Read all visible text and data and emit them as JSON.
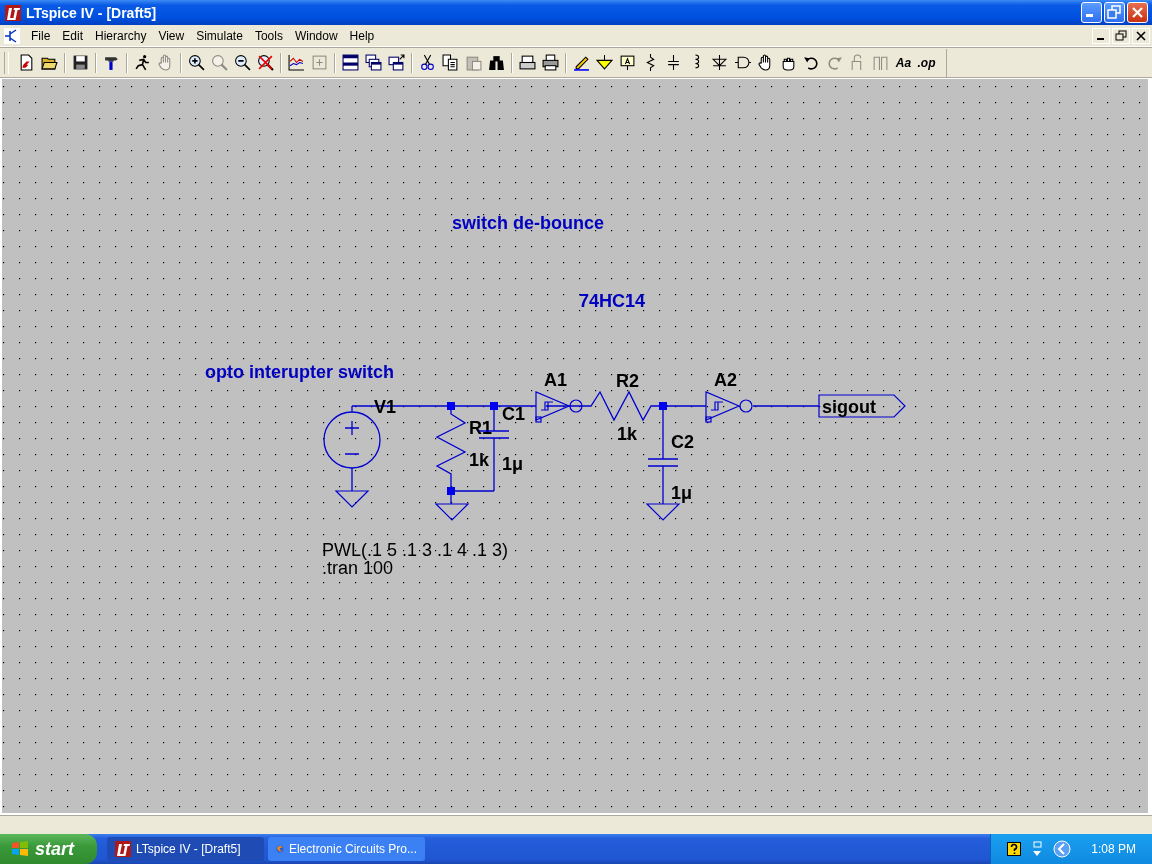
{
  "window": {
    "title": "LTspice IV - [Draft5]"
  },
  "menu": [
    "File",
    "Edit",
    "Hierarchy",
    "View",
    "Simulate",
    "Tools",
    "Window",
    "Help"
  ],
  "toolbar": [
    [
      {
        "kind": "new",
        "disabled": false
      },
      {
        "kind": "open",
        "disabled": false
      }
    ],
    [
      {
        "kind": "save",
        "disabled": false
      }
    ],
    [
      {
        "kind": "hammer",
        "disabled": false
      }
    ],
    [
      {
        "kind": "run",
        "disabled": false
      },
      {
        "kind": "halt",
        "disabled": true
      }
    ],
    [
      {
        "kind": "zoom_in",
        "disabled": false
      },
      {
        "kind": "pan",
        "disabled": true
      },
      {
        "kind": "zoom_out",
        "disabled": false
      },
      {
        "kind": "zoom_cancel",
        "disabled": false
      }
    ],
    [
      {
        "kind": "plot",
        "disabled": false
      },
      {
        "kind": "autorange",
        "disabled": true
      }
    ],
    [
      {
        "kind": "tile",
        "disabled": false
      },
      {
        "kind": "cascade",
        "disabled": false
      },
      {
        "kind": "cascade_arrow",
        "disabled": false
      }
    ],
    [
      {
        "kind": "cut",
        "disabled": false
      },
      {
        "kind": "copy",
        "disabled": false
      },
      {
        "kind": "paste",
        "disabled": true
      },
      {
        "kind": "find",
        "disabled": false
      }
    ],
    [
      {
        "kind": "print_setup",
        "disabled": false
      },
      {
        "kind": "print",
        "disabled": false
      }
    ],
    [
      {
        "kind": "wire",
        "disabled": false
      },
      {
        "kind": "ground",
        "disabled": false
      },
      {
        "kind": "label",
        "disabled": false
      },
      {
        "kind": "resistor",
        "disabled": false
      },
      {
        "kind": "capacitor",
        "disabled": false
      },
      {
        "kind": "inductor",
        "disabled": false
      },
      {
        "kind": "diode",
        "disabled": false
      },
      {
        "kind": "component",
        "disabled": false
      },
      {
        "kind": "move",
        "disabled": false
      },
      {
        "kind": "drag",
        "disabled": false
      },
      {
        "kind": "undo",
        "disabled": false
      },
      {
        "kind": "redo",
        "disabled": true
      },
      {
        "kind": "rotate",
        "disabled": true
      },
      {
        "kind": "mirror",
        "disabled": true
      },
      {
        "kind": "text",
        "disabled": false,
        "label": "Aa"
      },
      {
        "kind": "directive",
        "disabled": false,
        "label": ".op"
      }
    ]
  ],
  "schematic": {
    "comments": [
      "switch de-bounce",
      "74HC14",
      "opto interupter switch"
    ],
    "components": [
      {
        "kind": "voltage_source",
        "name": "V1",
        "value": "PWL(.1 5 .1 3 .1 4 .1 3)"
      },
      {
        "kind": "resistor",
        "name": "R1",
        "value": "1k"
      },
      {
        "kind": "capacitor",
        "name": "C1",
        "value": "1μ"
      },
      {
        "kind": "schmitt_inverter",
        "name": "A1"
      },
      {
        "kind": "resistor",
        "name": "R2",
        "value": "1k"
      },
      {
        "kind": "capacitor",
        "name": "C2",
        "value": "1μ"
      },
      {
        "kind": "schmitt_inverter",
        "name": "A2"
      }
    ],
    "net_labels": [
      "sigout"
    ],
    "directives": [
      ".tran 100"
    ]
  },
  "taskbar": {
    "start": "start",
    "tasks": [
      {
        "label": "LTspice IV - [Draft5]",
        "selected": true
      },
      {
        "label": "Electronic Circuits Pro...",
        "selected": false
      }
    ],
    "clock": "1:08 PM"
  }
}
